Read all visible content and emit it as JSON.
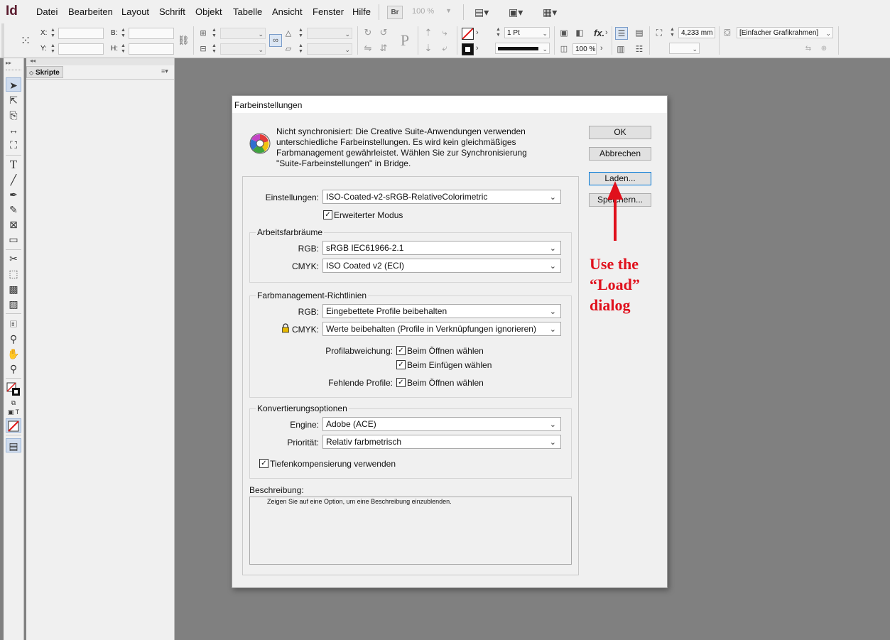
{
  "app": {
    "logo": "Id"
  },
  "menubar": {
    "items": [
      "Datei",
      "Bearbeiten",
      "Layout",
      "Schrift",
      "Objekt",
      "Tabelle",
      "Ansicht",
      "Fenster",
      "Hilfe"
    ],
    "br_label": "Br",
    "zoom": "100 %"
  },
  "controlbar": {
    "x_label": "X:",
    "y_label": "Y:",
    "b_label": "B:",
    "h_label": "H:",
    "stroke_weight": "1 Pt",
    "opacity": "100 %",
    "fx_label": "fx.",
    "spacing": "4,233 mm",
    "frame_style": "[Einfacher Grafikrahmen]",
    "p_glyph": "P"
  },
  "panel": {
    "tab_label": "Skripte"
  },
  "dialog": {
    "title": "Farbeinstellungen",
    "message_lines": [
      "Nicht synchronisiert: Die Creative Suite-Anwendungen verwenden",
      "unterschiedliche Farbeinstellungen. Es wird kein gleichmäßiges",
      "Farbmanagement gewährleistet. Wählen Sie zur Synchronisierung",
      "\"Suite-Farbeinstellungen\" in Bridge."
    ],
    "buttons": {
      "ok": "OK",
      "cancel": "Abbrechen",
      "load": "Laden...",
      "save": "Speichern..."
    },
    "settings": {
      "label": "Einstellungen:",
      "value": "ISO-Coated-v2-sRGB-RelativeColorimetric"
    },
    "advanced_mode": {
      "label": "Erweiterter Modus",
      "checked": true
    },
    "working_spaces": {
      "title": "Arbeitsfarbräume",
      "rgb_label": "RGB:",
      "rgb_value": "sRGB IEC61966-2.1",
      "cmyk_label": "CMYK:",
      "cmyk_value": "ISO Coated v2 (ECI)"
    },
    "policies": {
      "title": "Farbmanagement-Richtlinien",
      "rgb_label": "RGB:",
      "rgb_value": "Eingebettete Profile beibehalten",
      "cmyk_label": "CMYK:",
      "cmyk_value": "Werte beibehalten (Profile in Verknüpfungen ignorieren)",
      "mismatch_label": "Profilabweichung:",
      "ask_open": "Beim Öffnen wählen",
      "ask_paste": "Beim Einfügen wählen",
      "missing_label": "Fehlende Profile:",
      "missing_ask_open": "Beim Öffnen wählen"
    },
    "conversion": {
      "title": "Konvertierungsoptionen",
      "engine_label": "Engine:",
      "engine_value": "Adobe (ACE)",
      "intent_label": "Priorität:",
      "intent_value": "Relativ farbmetrisch",
      "bpc_label": "Tiefenkompensierung verwenden"
    },
    "description": {
      "title": "Beschreibung:",
      "text": "Zeigen Sie auf eine Option, um eine Beschreibung einzublenden."
    }
  },
  "annotation": {
    "text": "Use the\n“Load”\ndialog",
    "color": "#e0101c"
  }
}
